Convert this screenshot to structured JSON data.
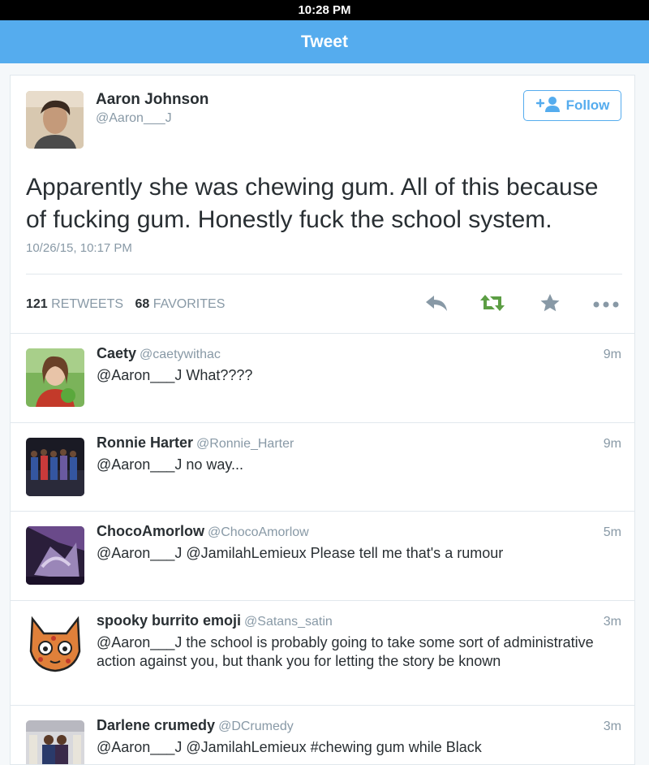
{
  "status_bar": {
    "time": "10:28 PM"
  },
  "nav": {
    "title": "Tweet"
  },
  "tweet": {
    "author_name": "Aaron Johnson",
    "author_handle": "@Aaron___J",
    "follow_label": "Follow",
    "text": "Apparently she was chewing gum. All of this because of fucking gum. Honestly fuck the school system.",
    "timestamp": "10/26/15, 10:17 PM",
    "retweets_count": "121",
    "retweets_label": "RETWEETS",
    "favorites_count": "68",
    "favorites_label": "FAVORITES"
  },
  "actions": {
    "icons": [
      "reply-icon",
      "retweet-icon",
      "favorite-icon",
      "more-icon"
    ],
    "retweet_color": "#5c9e44",
    "icon_color": "#8899a6"
  },
  "replies": [
    {
      "name": "Caety",
      "handle": "@caetywithac",
      "time": "9m",
      "text": "@Aaron___J What????"
    },
    {
      "name": "Ronnie Harter",
      "handle": "@Ronnie_Harter",
      "time": "9m",
      "text": "@Aaron___J no way..."
    },
    {
      "name": "ChocoAmorlow",
      "handle": "@ChocoAmorlow",
      "time": "5m",
      "text": "@Aaron___J @JamilahLemieux Please tell me that's a rumour"
    },
    {
      "name": "spooky burrito emoji",
      "handle": "@Satans_satin",
      "time": "3m",
      "text": "@Aaron___J the school is probably going to take some sort of administrative action against you, but thank you for letting the story be known"
    },
    {
      "name": "Darlene crumedy",
      "handle": "@DCrumedy",
      "time": "3m",
      "text": "@Aaron___J @JamilahLemieux #chewing gum while Black"
    }
  ],
  "colors": {
    "accent": "#55acee",
    "text": "#292f33",
    "muted": "#8899a6",
    "border": "#e1e8ed"
  }
}
